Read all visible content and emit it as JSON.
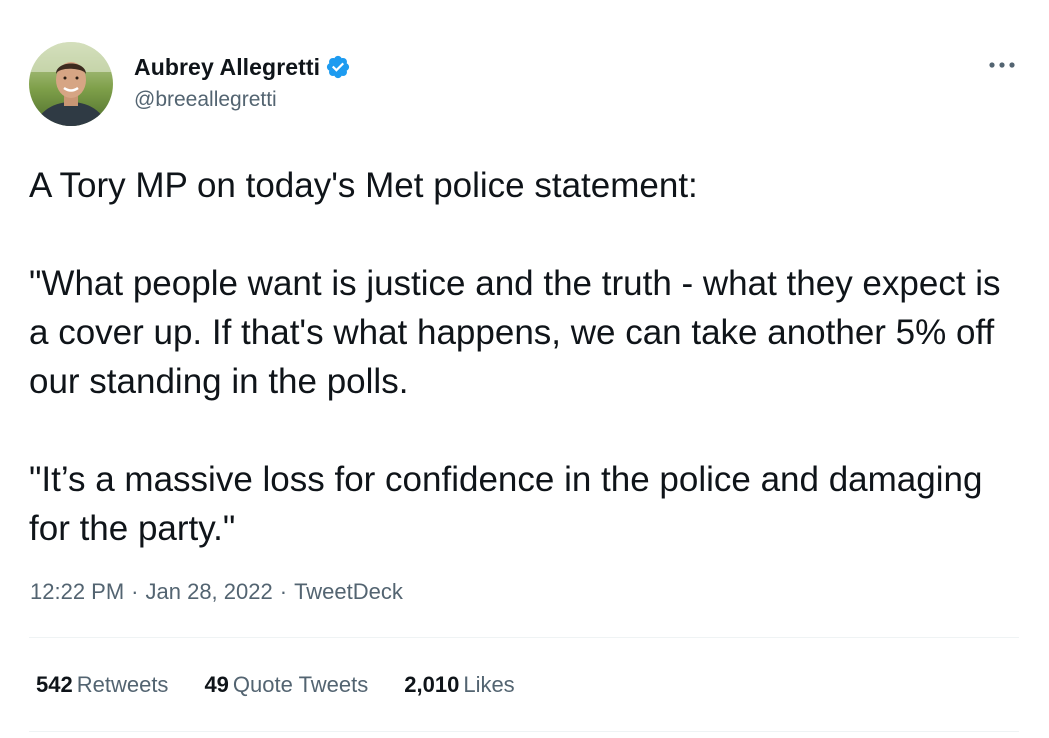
{
  "author": {
    "name": "Aubrey Allegretti",
    "handle": "@breeallegretti",
    "verified": true,
    "avatar": "profile-photo"
  },
  "more_icon": "more-horizontal-icon",
  "tweet": {
    "paragraphs": [
      "A Tory MP on today's Met police statement:",
      "\"What people want is justice and the truth - what they expect is a cover up. If that's what happens, we can take another 5% off our standing in the polls.",
      "\"It’s a massive loss for confidence in the police and damaging for the party.\""
    ]
  },
  "meta": {
    "time": "12:22 PM",
    "separator": "·",
    "date": "Jan 28, 2022",
    "source": "TweetDeck"
  },
  "stats": {
    "retweets_count": "542",
    "retweets_label": "Retweets",
    "quotes_count": "49",
    "quotes_label": "Quote Tweets",
    "likes_count": "2,010",
    "likes_label": "Likes"
  },
  "colors": {
    "text_primary": "#0f1419",
    "text_secondary": "#536471",
    "verified_blue": "#1d9bf0",
    "divider": "#eff3f4"
  }
}
